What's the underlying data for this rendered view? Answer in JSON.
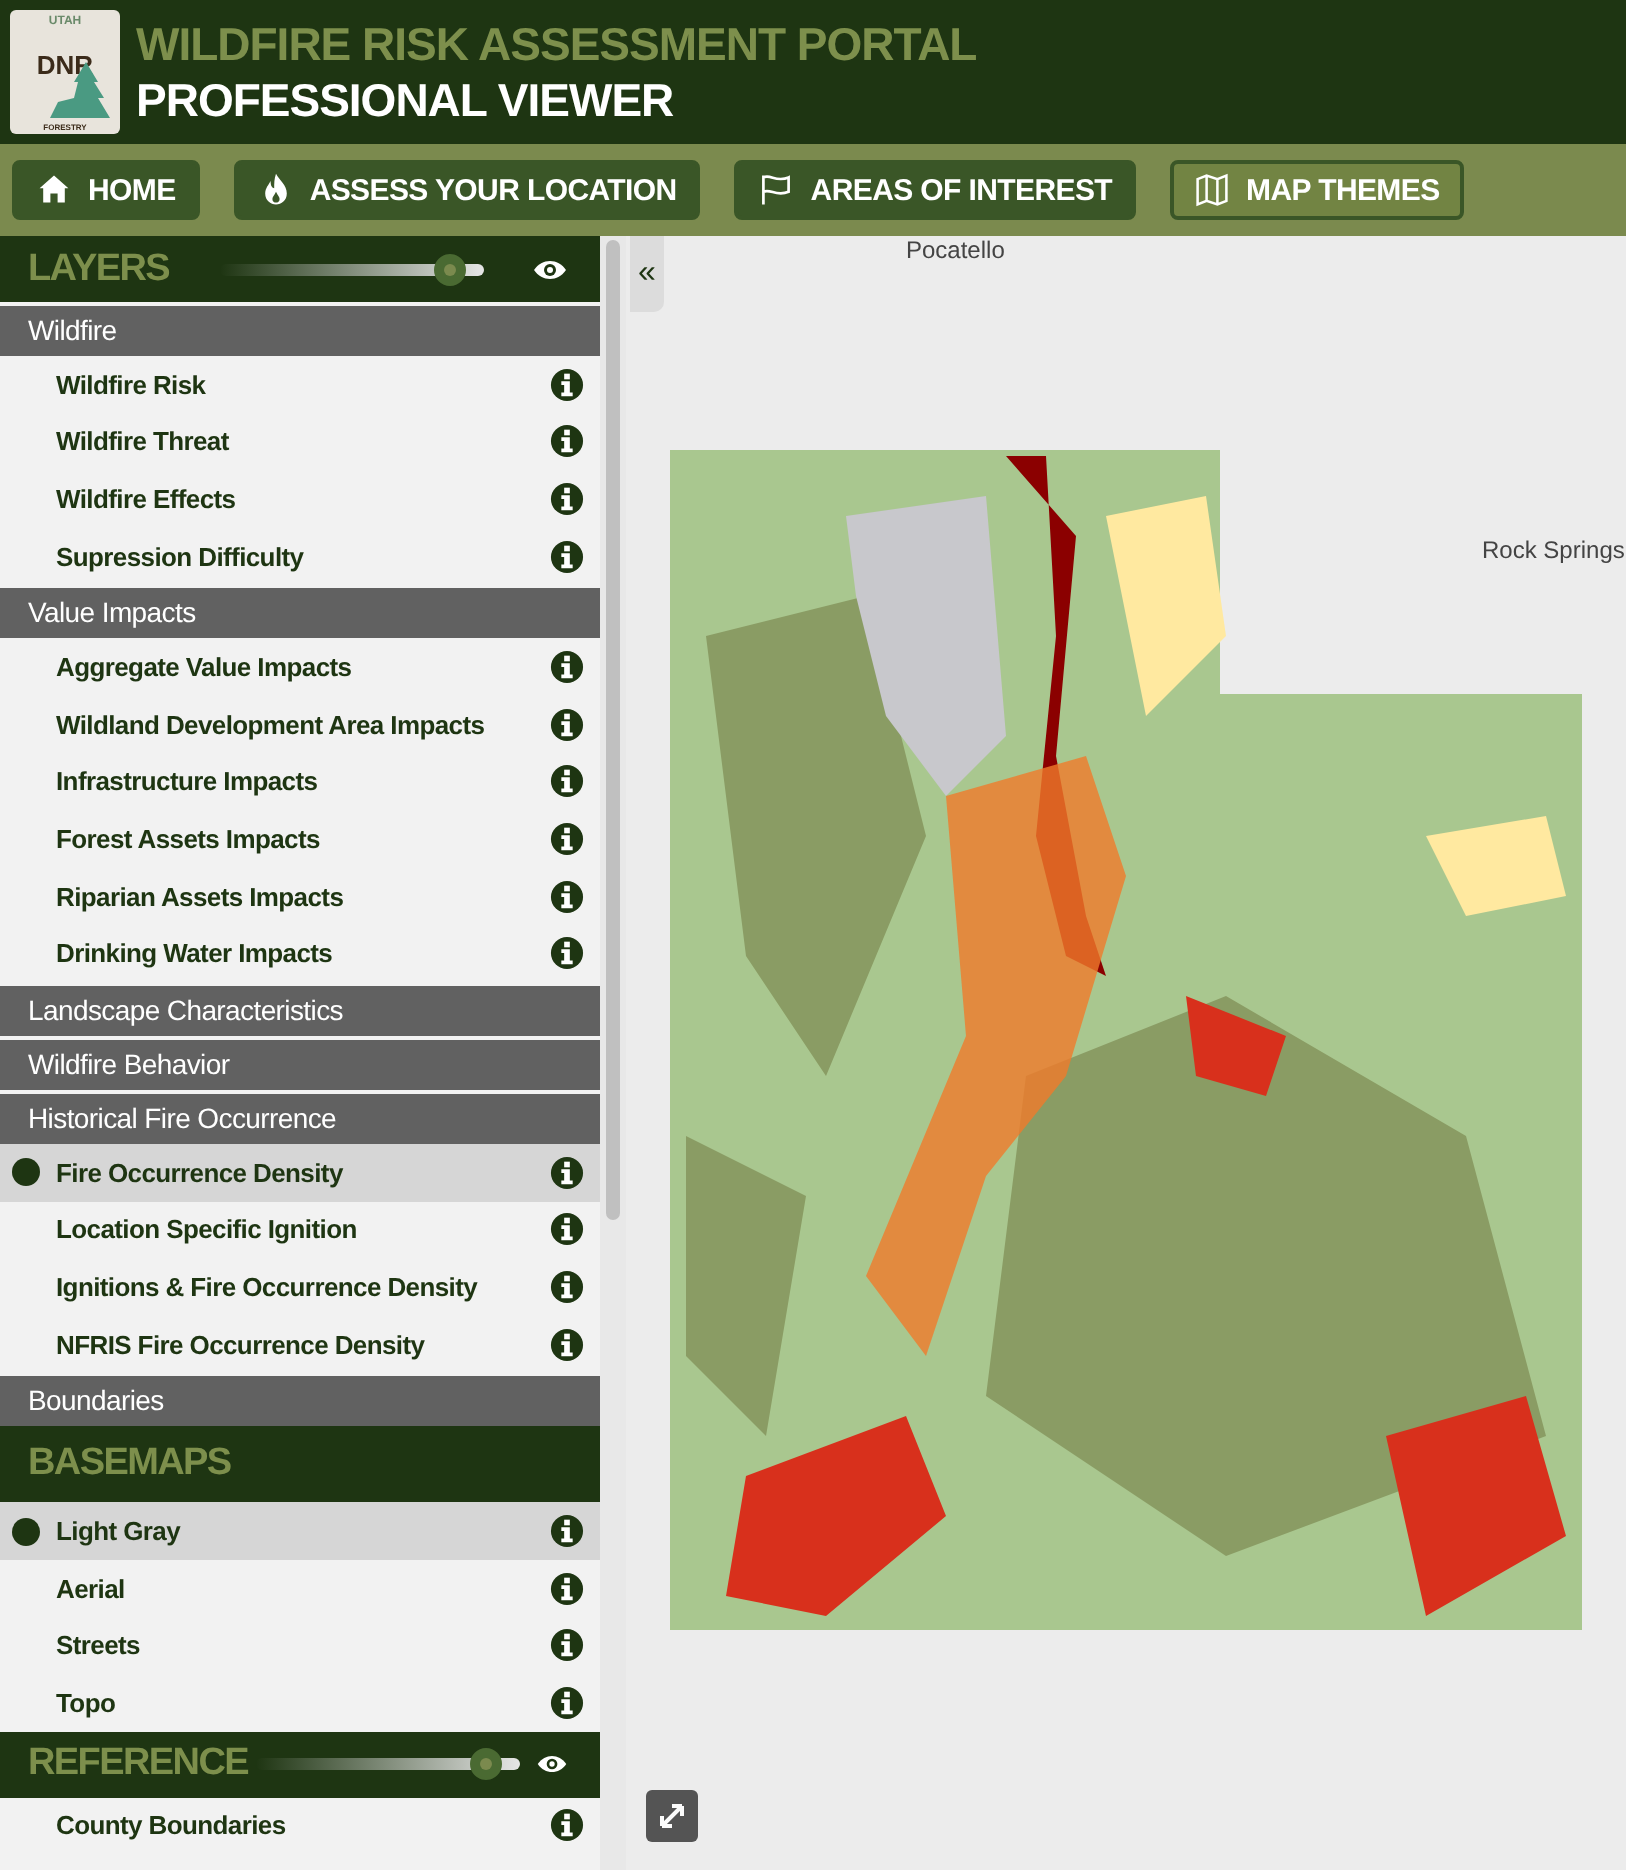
{
  "header": {
    "logo": {
      "top": "UTAH",
      "main": "DNR",
      "bottom": "FORESTRY"
    },
    "title": "WILDFIRE RISK ASSESSMENT PORTAL",
    "subtitle": "PROFESSIONAL VIEWER"
  },
  "nav": [
    {
      "kind": "home",
      "label": "HOME",
      "selected": false
    },
    {
      "kind": "fire",
      "label": "ASSESS YOUR LOCATION",
      "selected": false
    },
    {
      "kind": "flag",
      "label": "AREAS OF INTEREST",
      "selected": false
    },
    {
      "kind": "map",
      "label": "MAP THEMES",
      "selected": true
    }
  ],
  "sidebar": {
    "sections": [
      {
        "title": "LAYERS",
        "opacity": {
          "level": 0.92
        },
        "groups": [
          {
            "title": "Wildfire",
            "items": [
              {
                "label": "Wildfire Risk",
                "selected": false
              },
              {
                "label": "Wildfire Threat",
                "selected": false
              },
              {
                "label": "Wildfire Effects",
                "selected": false
              },
              {
                "label": "Supression Difficulty",
                "selected": false
              }
            ]
          },
          {
            "title": "Value Impacts",
            "items": [
              {
                "label": "Aggregate Value Impacts",
                "selected": false
              },
              {
                "label": "Wildland Development Area Impacts",
                "selected": false
              },
              {
                "label": "Infrastructure Impacts",
                "selected": false
              },
              {
                "label": "Forest Assets Impacts",
                "selected": false
              },
              {
                "label": "Riparian Assets Impacts",
                "selected": false
              },
              {
                "label": "Drinking Water Impacts",
                "selected": false
              }
            ]
          },
          {
            "title": "Landscape Characteristics"
          },
          {
            "title": "Wildfire Behavior"
          },
          {
            "title": "Historical Fire Occurrence",
            "items": [
              {
                "label": "Fire Occurrence Density",
                "selected": true
              },
              {
                "label": "Location Specific Ignition",
                "selected": false
              },
              {
                "label": "Ignitions & Fire Occurrence Density",
                "selected": false
              },
              {
                "label": "NFRIS Fire Occurrence Density",
                "selected": false
              }
            ]
          },
          {
            "title": "Boundaries"
          }
        ]
      },
      {
        "title": "BASEMAPS",
        "groups": [
          {
            "items": [
              {
                "label": "Light Gray",
                "selected": true
              },
              {
                "label": "Aerial",
                "selected": false
              },
              {
                "label": "Streets",
                "selected": false
              },
              {
                "label": "Topo",
                "selected": false
              }
            ]
          }
        ]
      },
      {
        "title": "REFERENCE",
        "opacity": {
          "level": 0.92
        },
        "groups": [
          {
            "items": [
              {
                "label": "County Boundaries",
                "selected": false
              }
            ]
          }
        ]
      }
    ]
  },
  "map": {
    "collapse_button": "«",
    "labels": [
      {
        "text": "Pocatello",
        "kind": "top"
      },
      {
        "text": "Rock Springs",
        "kind": "right"
      }
    ]
  }
}
